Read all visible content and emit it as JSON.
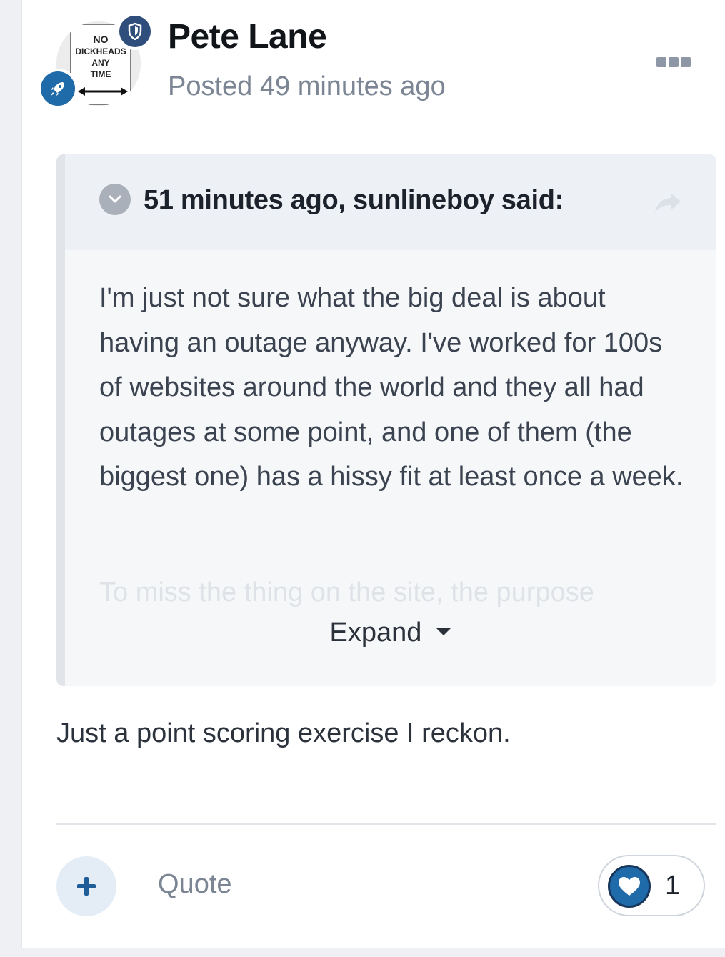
{
  "post": {
    "author": "Pete Lane",
    "posted_time": "Posted 49 minutes ago",
    "avatar_sign": {
      "line1": "NO",
      "line2": "DICKHEADS",
      "line3": "ANY",
      "line4": "TIME"
    },
    "icons": {
      "shield_badge": "shield-icon",
      "rank_badge": "rocket-icon",
      "menu": "ellipsis-icon"
    },
    "body": "Just a point scoring exercise I reckon."
  },
  "quote": {
    "citation": "51 minutes ago, sunlineboy said:",
    "paragraphs": [
      "I'm just not sure what the big deal is about having an outage anyway. I've worked for 100s of websites around the world and they all had outages at some point, and one of them (the biggest one) has a hissy fit at least once a week."
    ],
    "truncated_next_line": "To miss the thing on the site, the purpose",
    "expand_label": "Expand"
  },
  "footer": {
    "quote_label": "Quote",
    "reaction_count": "1",
    "reaction_icon": "heart-icon",
    "add_icon": "plus-icon"
  },
  "colors": {
    "accent": "#1f6aa8",
    "shield_badge": "#2f4e7c",
    "muted_text": "#7b8594",
    "quote_bg": "#f5f7f9"
  }
}
